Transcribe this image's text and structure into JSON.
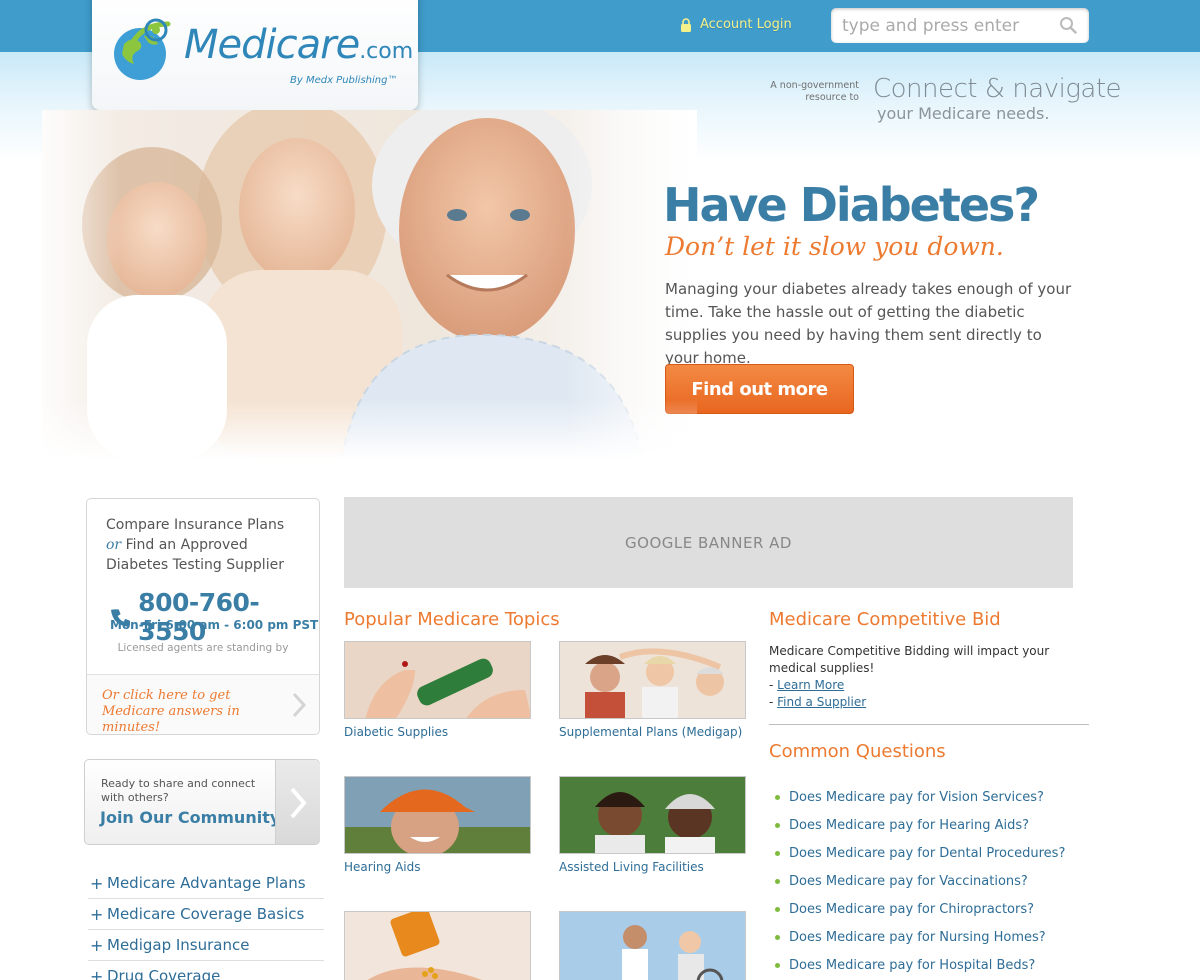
{
  "header": {
    "account_login": "Account Login",
    "search_placeholder": "type and press enter"
  },
  "logo": {
    "name": "Medicare",
    "tld": ".com",
    "byline": "By Medx Publishing™"
  },
  "tagline": {
    "small": "A non-government resource to",
    "big_line1": "Connect & navigate",
    "big_line2": "your Medicare needs."
  },
  "hero": {
    "title": "Have Diabetes?",
    "subtitle": "Don’t let it slow you down.",
    "body": "Managing your diabetes already takes enough of your time. Take the hassle out of getting the diabetic supplies you need by having them sent directly to your home.",
    "button": "Find out more"
  },
  "compare": {
    "line1": "Compare Insurance Plans",
    "or": "or",
    "line2": "Find an Approved Diabetes Testing Supplier",
    "phone": "800-760-3550",
    "hours": "Mon-Fri  6:00 am - 6:00 pm PST",
    "standing": "Licensed agents are standing by",
    "click_text": "Or click here to get Medicare answers in minutes!"
  },
  "community": {
    "small": "Ready to share and connect with others?",
    "join": "Join Our Community"
  },
  "side_nav": [
    "Medicare Advantage Plans",
    "Medicare Coverage Basics",
    "Medigap Insurance",
    "Drug Coverage"
  ],
  "ad": {
    "label": "GOOGLE BANNER AD"
  },
  "topics": {
    "title": "Popular Medicare Topics",
    "items": [
      {
        "label": "Diabetic Supplies"
      },
      {
        "label": "Supplemental Plans (Medigap)"
      },
      {
        "label": "Hearing Aids"
      },
      {
        "label": "Assisted Living Facilities"
      },
      {
        "label": ""
      },
      {
        "label": ""
      }
    ]
  },
  "competitive_bid": {
    "title": "Medicare Competitive Bid",
    "text": "Medicare Competitive Bidding will impact your medical supplies!",
    "learn_more": "Learn More",
    "find_supplier": "Find a Supplier"
  },
  "questions": {
    "title": "Common Questions",
    "items": [
      "Does Medicare pay for Vision Services?",
      "Does Medicare pay for Hearing Aids?",
      "Does Medicare pay for Dental Procedures?",
      "Does Medicare pay for Vaccinations?",
      "Does Medicare pay for Chiropractors?",
      "Does Medicare pay for Nursing Homes?",
      "Does Medicare pay for Hospital Beds?"
    ]
  },
  "colors": {
    "brand_blue": "#3a7ea6",
    "topbar": "#3f9ccb",
    "accent_orange": "#ec7a31",
    "link": "#2e6d97",
    "bullet_green": "#7dbb3c"
  }
}
